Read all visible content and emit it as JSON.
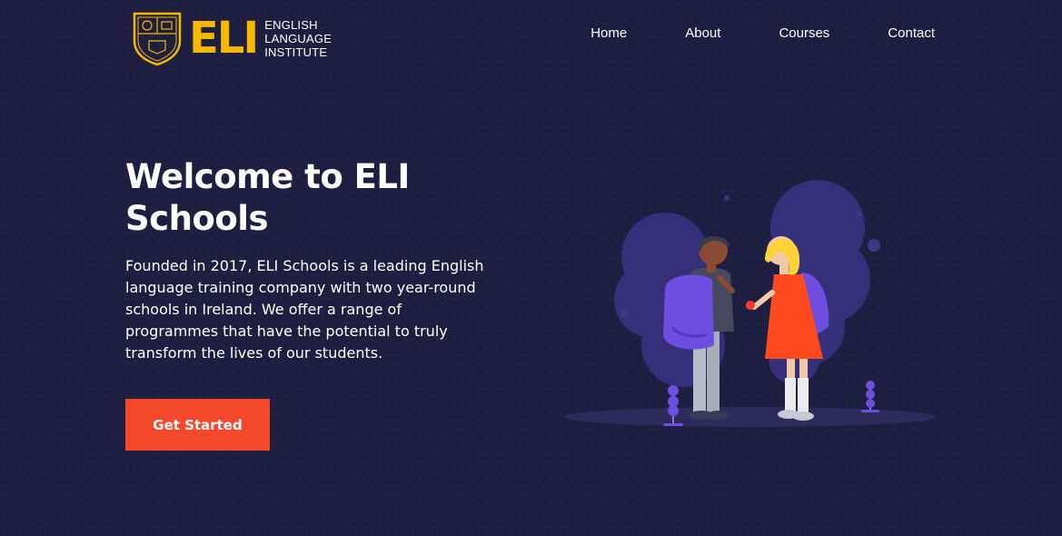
{
  "header": {
    "logo": {
      "mark": "ELI",
      "text_lines": [
        "ENGLISH",
        "LANGUAGE",
        "INSTITUTE"
      ]
    },
    "nav": [
      {
        "label": "Home"
      },
      {
        "label": "About"
      },
      {
        "label": "Courses"
      },
      {
        "label": "Contact"
      }
    ]
  },
  "hero": {
    "title": "Welcome to ELI Schools",
    "description": "Founded in 2017, ELI Schools is a leading English language training company with two year-round schools in Ireland. We offer a range of programmes that have the potential to truly transform the lives of our students.",
    "cta_label": "Get Started",
    "illustration": "students-with-backpacks-illustration"
  },
  "colors": {
    "background": "#1e1f40",
    "accent": "#f4482a",
    "logo_gold": "#f5b800",
    "purple": "#6c4fe0",
    "bush": "#36307a"
  }
}
